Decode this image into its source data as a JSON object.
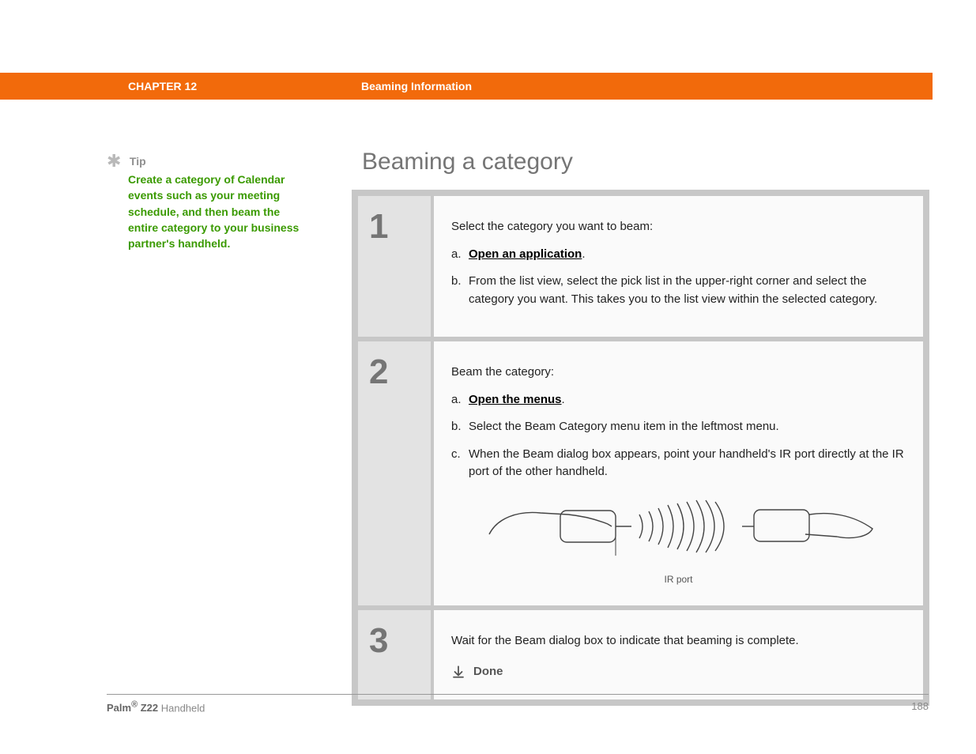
{
  "header": {
    "chapter": "CHAPTER 12",
    "topic": "Beaming Information"
  },
  "tip": {
    "label": "Tip",
    "text": "Create a category of Calendar events such as your meeting schedule, and then beam the entire category to your business partner's handheld."
  },
  "title": "Beaming a category",
  "steps": [
    {
      "num": "1",
      "intro": "Select the category you want to beam:",
      "items": [
        {
          "marker": "a.",
          "link": "Open an application",
          "suffix": "."
        },
        {
          "marker": "b.",
          "text": "From the list view, select the pick list in the upper-right corner and select the category you want. This takes you to the list view within the selected category."
        }
      ]
    },
    {
      "num": "2",
      "intro": "Beam the category:",
      "items": [
        {
          "marker": "a.",
          "link": "Open the menus",
          "suffix": "."
        },
        {
          "marker": "b.",
          "text": "Select the Beam Category menu item in the leftmost menu."
        },
        {
          "marker": "c.",
          "text": "When the Beam dialog box appears, point your handheld's IR port directly at the IR port of the other handheld."
        }
      ],
      "figure_caption": "IR port"
    },
    {
      "num": "3",
      "intro": "Wait for the Beam dialog box to indicate that beaming is complete.",
      "done": "Done"
    }
  ],
  "footer": {
    "brand": "Palm",
    "model": "Z22",
    "product": "Handheld",
    "page": "188"
  }
}
